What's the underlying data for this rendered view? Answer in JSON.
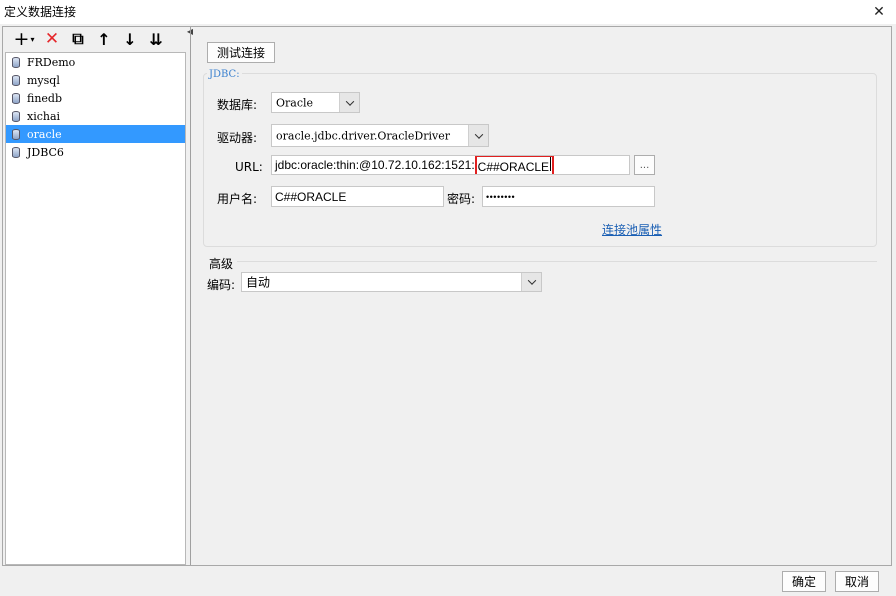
{
  "window": {
    "title": "定义数据连接",
    "close": "✕"
  },
  "toolbar": {
    "add": "+",
    "add_caret": "▾",
    "delete": "✕",
    "copy": "⧉",
    "up": "↑",
    "down": "↓",
    "sort": "⇊"
  },
  "connections": [
    {
      "name": "FRDemo",
      "selected": false
    },
    {
      "name": "mysql",
      "selected": false
    },
    {
      "name": "finedb",
      "selected": false
    },
    {
      "name": "xichai",
      "selected": false
    },
    {
      "name": "oracle",
      "selected": true
    },
    {
      "name": "JDBC6",
      "selected": false
    }
  ],
  "main": {
    "test_button": "测试连接",
    "jdbc": {
      "legend": "JDBC:",
      "database_label": "数据库:",
      "database_value": "Oracle",
      "driver_label": "驱动器:",
      "driver_value": "oracle.jdbc.driver.OracleDriver",
      "url_label": "URL:",
      "url_prefix": "jdbc:oracle:thin:@10.72.10.162:1521:",
      "url_highlight": "C##ORACLE",
      "url_more": "...",
      "user_label": "用户名:",
      "user_value": "C##ORACLE",
      "password_label": "密码:",
      "password_value": "••••••••",
      "pool_link": "连接池属性"
    },
    "advanced": {
      "heading": "高级",
      "encoding_label": "编码:",
      "encoding_value": "自动"
    }
  },
  "footer": {
    "ok": "确定",
    "cancel": "取消"
  },
  "colors": {
    "selection": "#3399ff",
    "link": "#1a5fb4",
    "highlight_box": "#e02020",
    "legend": "#3a80cf"
  }
}
